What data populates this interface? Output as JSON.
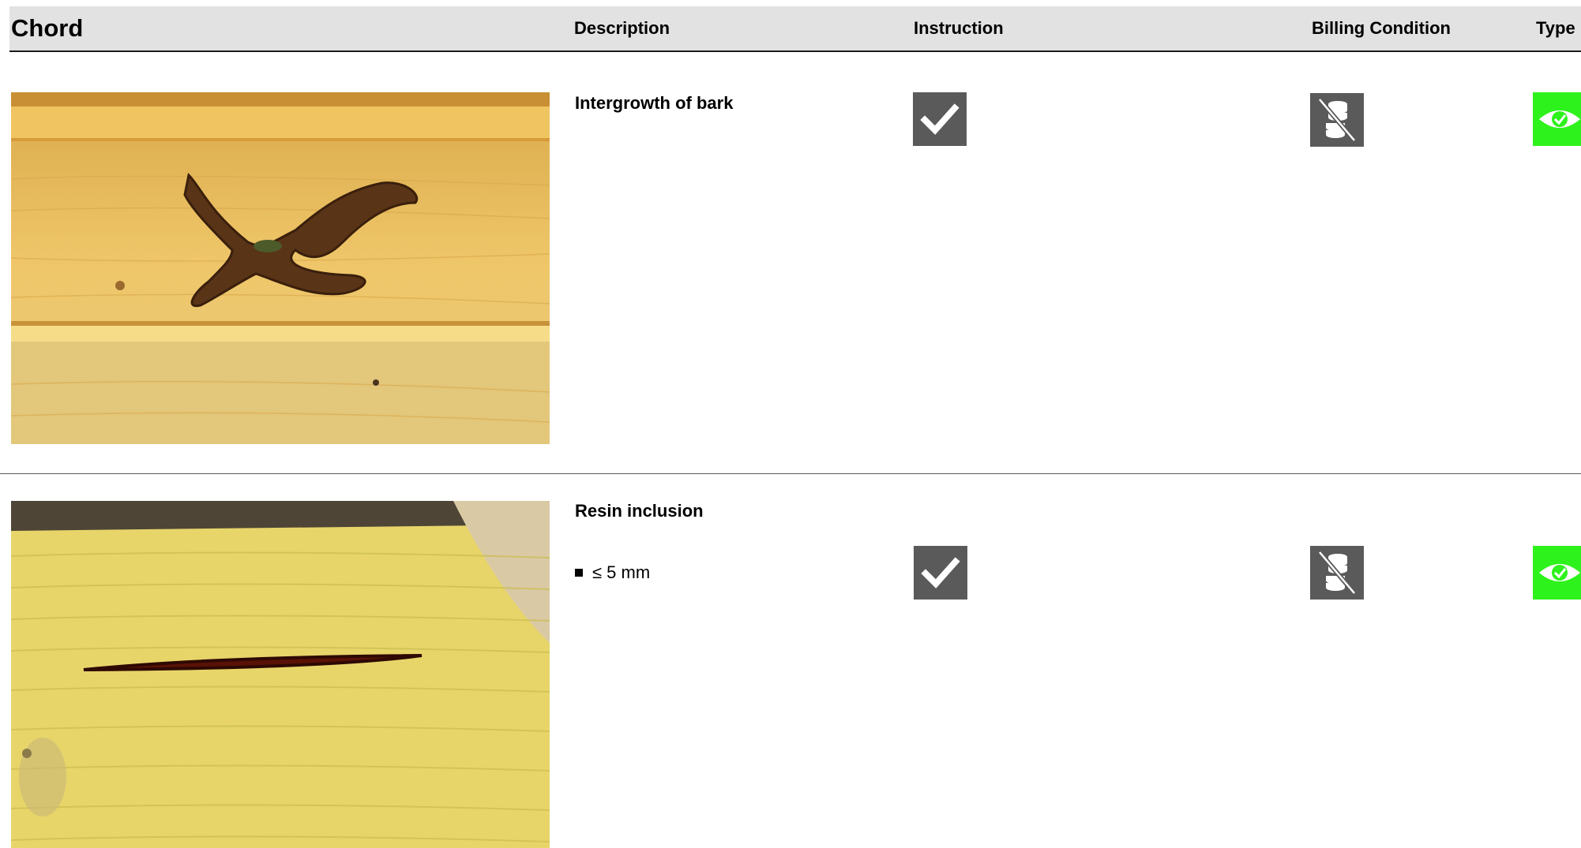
{
  "header": {
    "chord": "Chord",
    "description": "Description",
    "instruction": "Instruction",
    "billing_condition": "Billing Condition",
    "type": "Type"
  },
  "colors": {
    "header_bg": "#e2e2e2",
    "icon_dark": "#5a5a5a",
    "type_green": "#2ef21c",
    "wood": "#e9c36a"
  },
  "rows": [
    {
      "photo_icon": "wood-bark-photo",
      "title": "Intergrowth of bark",
      "bullet": "",
      "instruction_icon": "checkmark-icon",
      "billing_icon": "no-coins-icon",
      "type_icon": "eye-icon"
    },
    {
      "photo_icon": "wood-resin-photo",
      "title": "Resin inclusion",
      "bullet": "≤ 5 mm",
      "instruction_icon": "checkmark-icon",
      "billing_icon": "no-coins-icon",
      "type_icon": "eye-icon"
    }
  ]
}
